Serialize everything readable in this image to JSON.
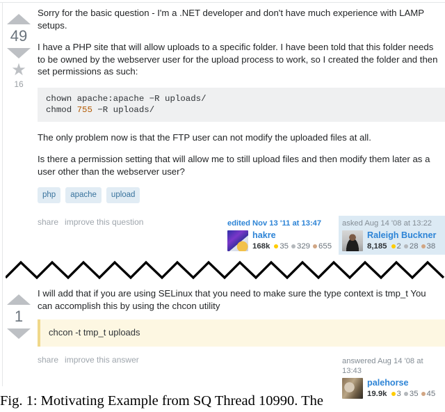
{
  "caption": "Fig.  1:  Motivating  Example  from  SQ  Thread  10990.  The",
  "question": {
    "votes": "49",
    "favorites": "16",
    "paragraphs": [
      "Sorry for the basic question - I'm a .NET developer and don't have much experience with LAMP setups.",
      "I have a PHP site that will allow uploads to a specific folder. I have been told that this folder needs to be owned by the webserver user for the upload process to work, so I created the folder and then set permissions as such:",
      "The only problem now is that the FTP user can not modify the uploaded files at all.",
      "Is there a permission setting that will allow me to still upload files and then modify them later as a user other than the webserver user?"
    ],
    "code": {
      "line1_pre": "chown apache:apache −R uploads/",
      "line2_pre": "chmod ",
      "line2_num": "755",
      "line2_post": " −R uploads/"
    },
    "tags": [
      "php",
      "apache",
      "upload"
    ],
    "actions": [
      "share",
      "improve this question"
    ],
    "editor_card": {
      "action": "edited Nov 13 '11 at 13:47",
      "name": "hakre",
      "reputation": "168k",
      "gold": "35",
      "silver": "329",
      "bronze": "655"
    },
    "asker_card": {
      "action": "asked Aug 14 '08 at 13:22",
      "name": "Raleigh Buckner",
      "reputation": "8,185",
      "gold": "2",
      "silver": "28",
      "bronze": "38"
    }
  },
  "answer": {
    "votes": "1",
    "text": "I will add that if you are using SELinux that you need to make sure the type context is tmp_t You can accomplish this by using the chcon utility",
    "code": "chcon -t tmp_t uploads",
    "actions": [
      "share",
      "improve this answer"
    ],
    "answerer_card": {
      "action": "answered Aug 14 '08 at 13:43",
      "name": "palehorse",
      "reputation": "19.9k",
      "gold": "3",
      "silver": "35",
      "bronze": "45"
    }
  },
  "colors": {
    "link": "#2d84d6",
    "tag_bg": "#e1ecf4",
    "tag_fg": "#39739d",
    "code_bg": "#eff0f1",
    "answer_code_bg": "#fdf7e2",
    "highlight_card_bg": "#dceaf4",
    "gold": "#ffcc01",
    "silver": "#b4b8bc",
    "bronze": "#d1a684"
  }
}
